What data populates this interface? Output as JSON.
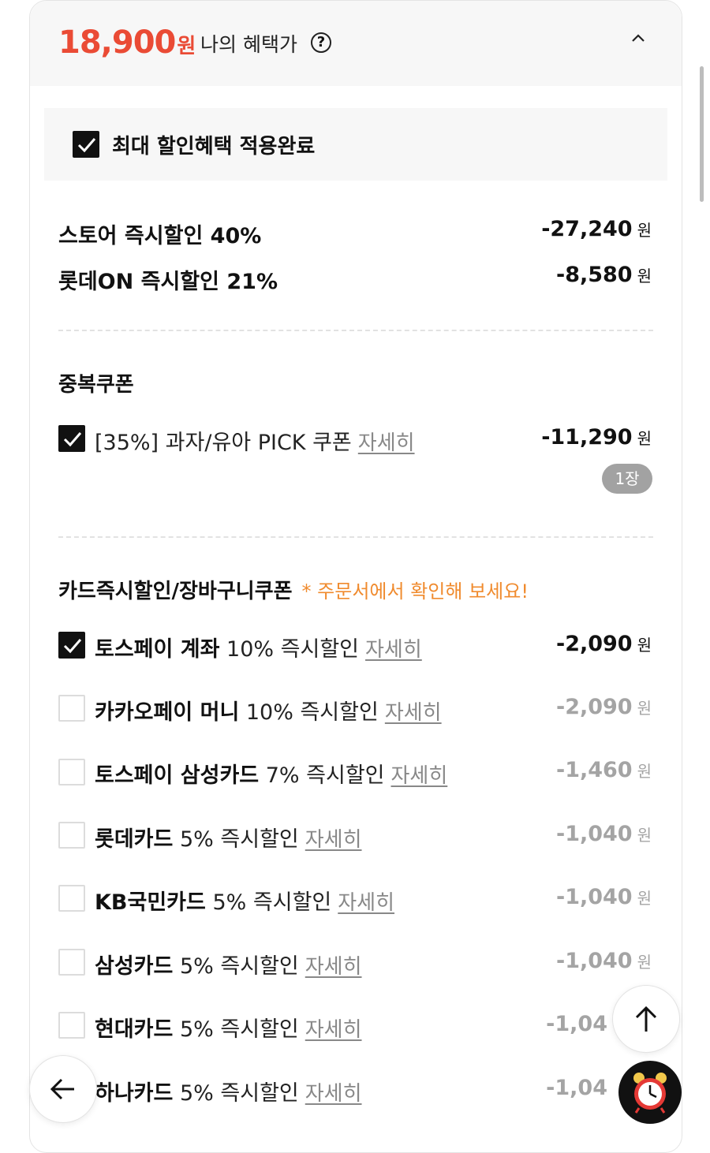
{
  "header": {
    "price": "18,900",
    "price_unit": "원",
    "benefit_label": "나의 혜택가",
    "help_icon": "?"
  },
  "applied": {
    "label": "최대 할인혜택 적용완료",
    "checked": true
  },
  "instant_discounts": [
    {
      "label": "스토어 즉시할인 40%",
      "amount": "-27,240",
      "unit": "원"
    },
    {
      "label": "롯데ON 즉시할인 21%",
      "amount": "-8,580",
      "unit": "원"
    }
  ],
  "coupon_section": {
    "title": "중복쿠폰",
    "item": {
      "label": "[35%] 과자/유아 PICK 쿠폰",
      "detail": "자세히",
      "amount": "-11,290",
      "unit": "원",
      "quantity": "1장",
      "checked": true
    }
  },
  "card_section": {
    "title": "카드즉시할인/장바구니쿠폰",
    "note": "* 주문서에서 확인해 보세요!",
    "items": [
      {
        "name": "토스페이 계좌",
        "desc": "10% 즉시할인",
        "detail": "자세히",
        "amount": "-2,090",
        "unit": "원",
        "checked": true
      },
      {
        "name": "카카오페이 머니",
        "desc": "10% 즉시할인",
        "detail": "자세히",
        "amount": "-2,090",
        "unit": "원",
        "checked": false
      },
      {
        "name": "토스페이 삼성카드",
        "desc": "7% 즉시할인",
        "detail": "자세히",
        "amount": "-1,460",
        "unit": "원",
        "checked": false
      },
      {
        "name": "롯데카드",
        "desc": "5% 즉시할인",
        "detail": "자세히",
        "amount": "-1,040",
        "unit": "원",
        "checked": false
      },
      {
        "name": "KB국민카드",
        "desc": "5% 즉시할인",
        "detail": "자세히",
        "amount": "-1,040",
        "unit": "원",
        "checked": false
      },
      {
        "name": "삼성카드",
        "desc": "5% 즉시할인",
        "detail": "자세히",
        "amount": "-1,040",
        "unit": "원",
        "checked": false
      },
      {
        "name": "현대카드",
        "desc": "5% 즉시할인",
        "detail": "자세히",
        "amount": "-1,04",
        "unit": "",
        "checked": false
      },
      {
        "name": "하나카드",
        "desc": "5% 즉시할인",
        "detail": "자세히",
        "amount": "-1,04",
        "unit": "",
        "checked": false
      }
    ]
  },
  "floating": {
    "scroll_top_icon": "arrow-up-icon",
    "back_icon": "arrow-left-icon",
    "alarm_icon": "alarm-clock-icon"
  },
  "colors": {
    "price": "#ea4b35",
    "note": "#f08b2e",
    "muted": "#a4a4a4",
    "checked": "#111111"
  }
}
